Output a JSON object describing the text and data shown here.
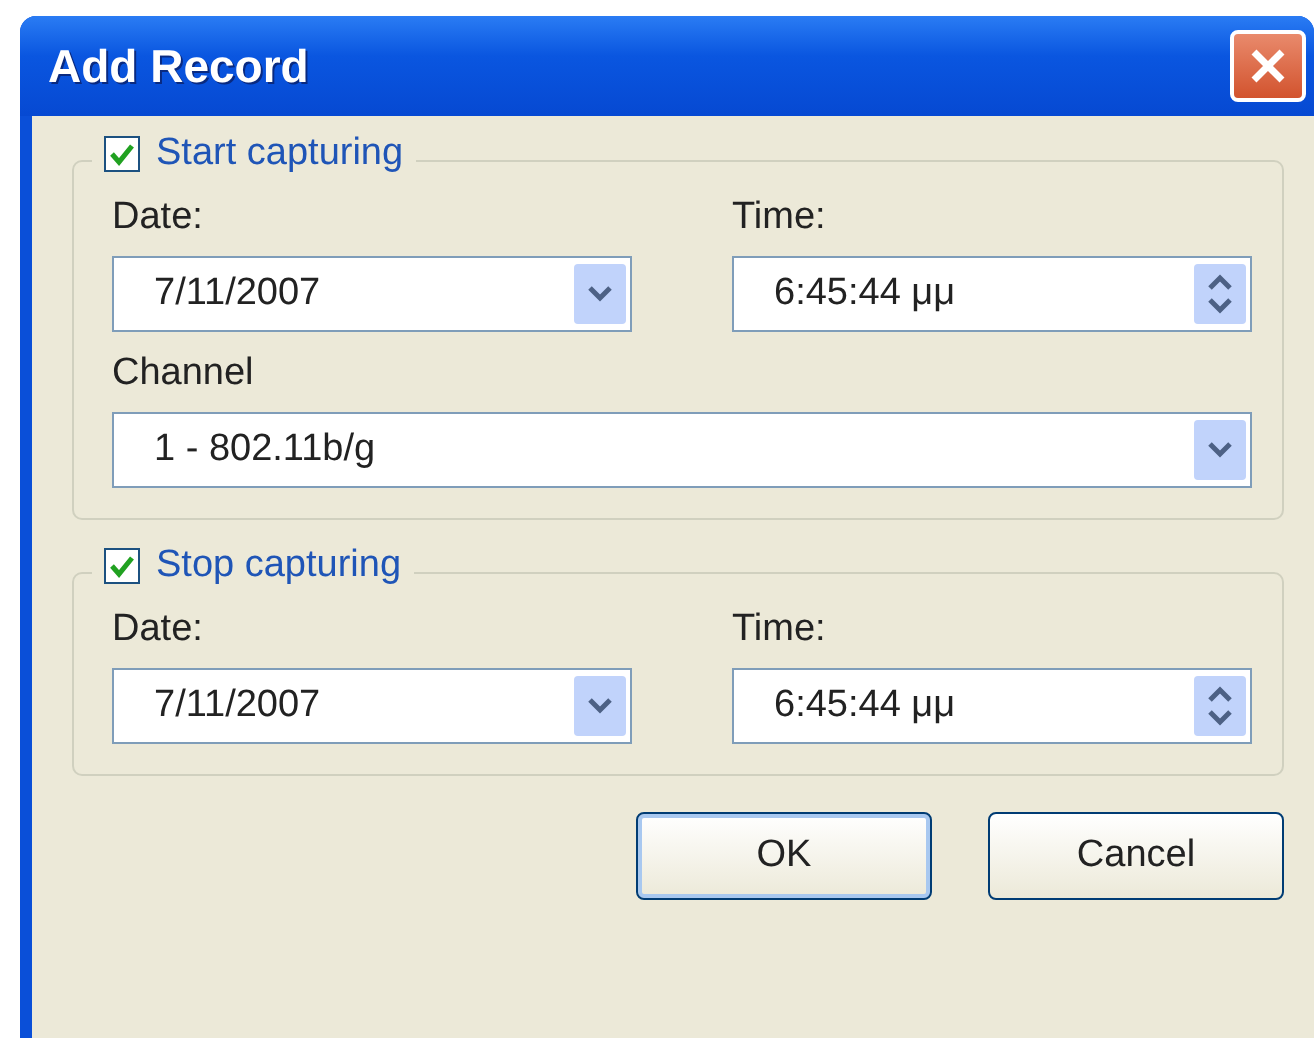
{
  "window": {
    "title": "Add Record"
  },
  "groups": [
    {
      "label": "Start capturing",
      "checked": true,
      "rows": [
        [
          {
            "label": "Date:",
            "value": "7/11/2007",
            "kind": "dropdown"
          },
          {
            "label": "Time:",
            "value": "6:45:44 μμ",
            "kind": "spinner"
          }
        ],
        [
          {
            "label": "Channel",
            "value": "1 - 802.11b/g",
            "kind": "dropdown"
          }
        ]
      ]
    },
    {
      "label": "Stop capturing",
      "checked": true,
      "rows": [
        [
          {
            "label": "Date:",
            "value": "7/11/2007",
            "kind": "dropdown"
          },
          {
            "label": "Time:",
            "value": "6:45:44 μμ",
            "kind": "spinner"
          }
        ]
      ]
    }
  ],
  "buttons": [
    {
      "label": "OK",
      "kind": "default"
    },
    {
      "label": "Cancel",
      "kind": "normal"
    }
  ]
}
